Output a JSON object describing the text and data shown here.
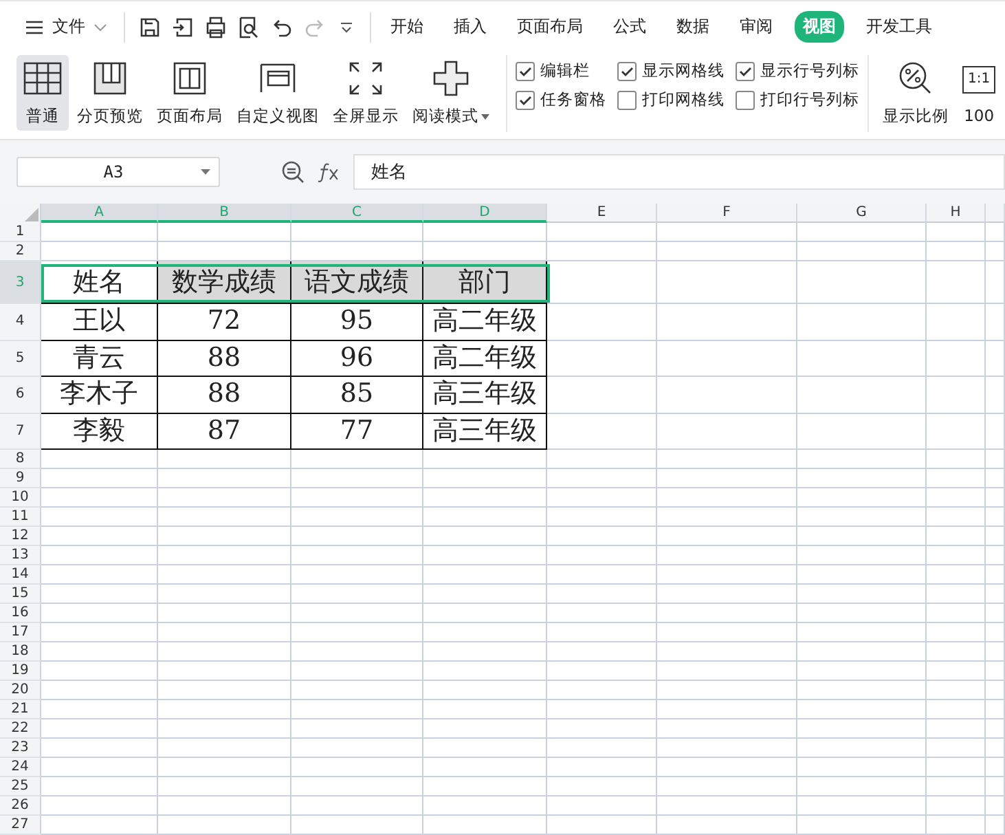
{
  "menu": {
    "label": "文件"
  },
  "tabs": [
    {
      "label": "开始",
      "selected": false
    },
    {
      "label": "插入",
      "selected": false
    },
    {
      "label": "页面布局",
      "selected": false
    },
    {
      "label": "公式",
      "selected": false
    },
    {
      "label": "数据",
      "selected": false
    },
    {
      "label": "审阅",
      "selected": false
    },
    {
      "label": "视图",
      "selected": true
    },
    {
      "label": "开发工具",
      "selected": false
    }
  ],
  "view_buttons": [
    {
      "kind": "grid",
      "label": "普通",
      "selected": true,
      "dropdown": false
    },
    {
      "kind": "pagebreak",
      "label": "分页预览",
      "selected": false,
      "dropdown": false
    },
    {
      "kind": "layout",
      "label": "页面布局",
      "selected": false,
      "dropdown": false
    },
    {
      "kind": "custom",
      "label": "自定义视图",
      "selected": false,
      "dropdown": false
    },
    {
      "kind": "fullscreen",
      "label": "全屏显示",
      "selected": false,
      "dropdown": false
    },
    {
      "kind": "reading",
      "label": "阅读模式",
      "selected": false,
      "dropdown": true
    }
  ],
  "checkboxes": [
    {
      "label": "编辑栏",
      "checked": true
    },
    {
      "label": "显示网格线",
      "checked": true
    },
    {
      "label": "显示行号列标",
      "checked": true
    },
    {
      "label": "任务窗格",
      "checked": true
    },
    {
      "label": "打印网格线",
      "checked": false
    },
    {
      "label": "打印行号列标",
      "checked": false
    }
  ],
  "zoom": {
    "label": "显示比例"
  },
  "actual_size": {
    "icon_text": "1:1",
    "label": "100"
  },
  "name_box": {
    "value": "A3"
  },
  "formula": {
    "value": "姓名"
  },
  "columns": [
    {
      "label": "A",
      "selected": true
    },
    {
      "label": "B",
      "selected": true
    },
    {
      "label": "C",
      "selected": true
    },
    {
      "label": "D",
      "selected": true
    },
    {
      "label": "E",
      "selected": false
    },
    {
      "label": "F",
      "selected": false
    },
    {
      "label": "G",
      "selected": false
    },
    {
      "label": "H",
      "selected": false
    }
  ],
  "rows": [
    {
      "number": "1",
      "selected": false
    },
    {
      "number": "2",
      "selected": false
    },
    {
      "number": "3",
      "selected": true,
      "cells": [
        {
          "text": "姓名",
          "shaded": false
        },
        {
          "text": "数学成绩",
          "shaded": true
        },
        {
          "text": "语文成绩",
          "shaded": true
        },
        {
          "text": "部门",
          "shaded": true
        }
      ]
    },
    {
      "number": "4",
      "selected": false,
      "cells": [
        {
          "text": "王以",
          "shaded": false
        },
        {
          "text": "72",
          "shaded": false
        },
        {
          "text": "95",
          "shaded": false
        },
        {
          "text": "高二年级",
          "shaded": false
        }
      ]
    },
    {
      "number": "5",
      "selected": false,
      "cells": [
        {
          "text": "青云",
          "shaded": false
        },
        {
          "text": "88",
          "shaded": false
        },
        {
          "text": "96",
          "shaded": false
        },
        {
          "text": "高二年级",
          "shaded": false
        }
      ]
    },
    {
      "number": "6",
      "selected": false,
      "cells": [
        {
          "text": "李木子",
          "shaded": false
        },
        {
          "text": "88",
          "shaded": false
        },
        {
          "text": "85",
          "shaded": false
        },
        {
          "text": "高三年级",
          "shaded": false
        }
      ]
    },
    {
      "number": "7",
      "selected": false,
      "cells": [
        {
          "text": "李毅",
          "shaded": false
        },
        {
          "text": "87",
          "shaded": false
        },
        {
          "text": "77",
          "shaded": false
        },
        {
          "text": "高三年级",
          "shaded": false
        }
      ]
    },
    {
      "number": "8",
      "selected": false
    },
    {
      "number": "9",
      "selected": false
    },
    {
      "number": "10",
      "selected": false
    },
    {
      "number": "11",
      "selected": false
    },
    {
      "number": "12",
      "selected": false
    },
    {
      "number": "13",
      "selected": false
    },
    {
      "number": "14",
      "selected": false
    },
    {
      "number": "15",
      "selected": false
    },
    {
      "number": "16",
      "selected": false
    },
    {
      "number": "17",
      "selected": false
    },
    {
      "number": "18",
      "selected": false
    },
    {
      "number": "19",
      "selected": false
    },
    {
      "number": "20",
      "selected": false
    },
    {
      "number": "21",
      "selected": false
    },
    {
      "number": "22",
      "selected": false
    },
    {
      "number": "23",
      "selected": false
    },
    {
      "number": "24",
      "selected": false
    },
    {
      "number": "25",
      "selected": false
    },
    {
      "number": "26",
      "selected": false
    },
    {
      "number": "27",
      "selected": false
    }
  ]
}
